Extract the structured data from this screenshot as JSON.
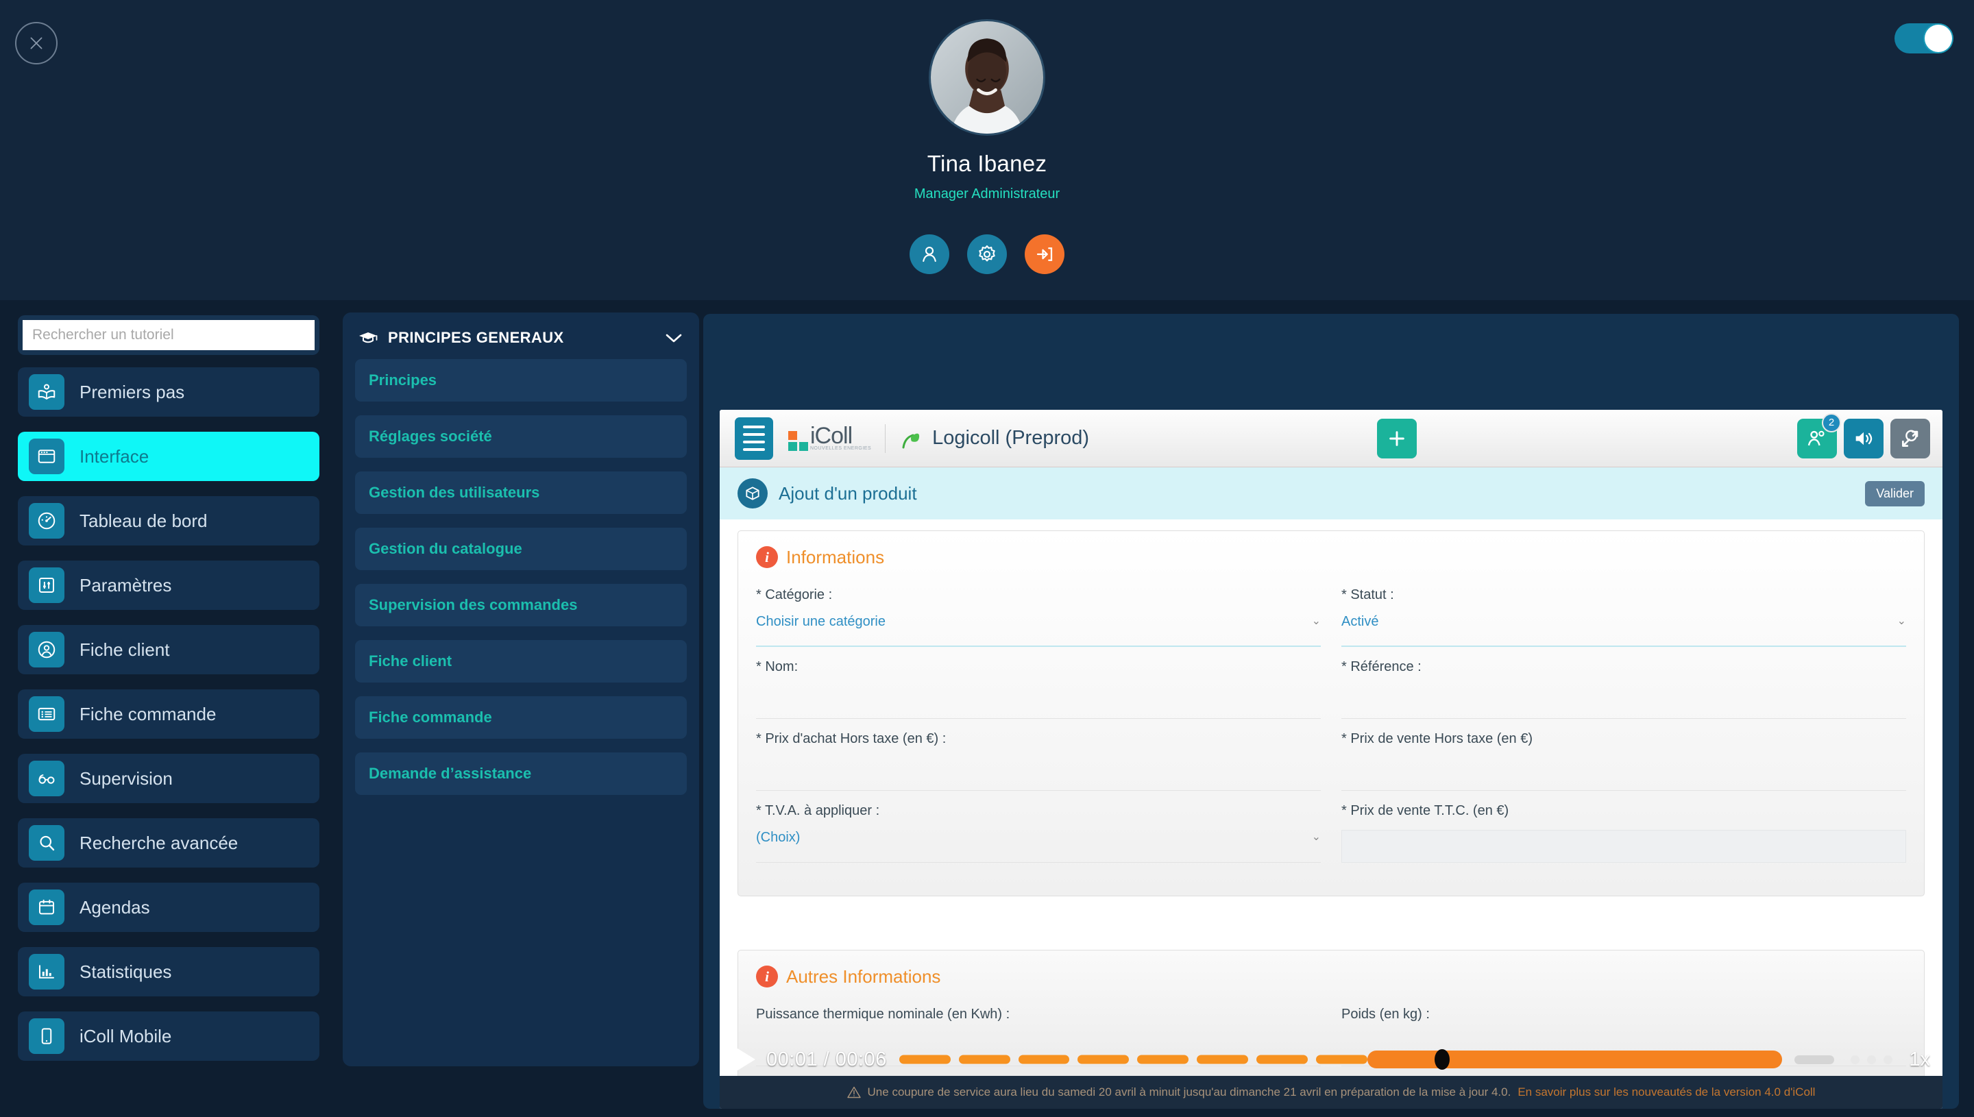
{
  "header": {
    "close_label": "×",
    "user_name": "Tina Ibanez",
    "user_role": "Manager Administrateur",
    "toggle_state": "on",
    "actions": [
      {
        "name": "profile",
        "icon": "user-icon",
        "color": "#1b7fa3"
      },
      {
        "name": "settings",
        "icon": "gear-icon",
        "color": "#1b7fa3"
      },
      {
        "name": "logout",
        "icon": "logout-icon",
        "color": "#f4722b"
      }
    ]
  },
  "sidebar": {
    "search_placeholder": "Rechercher un tutoriel",
    "search_value": "",
    "items": [
      {
        "label": "Premiers pas",
        "icon": "book-reader-icon",
        "active": false
      },
      {
        "label": "Interface",
        "icon": "window-icon",
        "active": true
      },
      {
        "label": "Tableau de bord",
        "icon": "gauge-icon",
        "active": false
      },
      {
        "label": "Paramètres",
        "icon": "sliders-icon",
        "active": false
      },
      {
        "label": "Fiche client",
        "icon": "user-circle-icon",
        "active": false
      },
      {
        "label": "Fiche commande",
        "icon": "list-card-icon",
        "active": false
      },
      {
        "label": "Supervision",
        "icon": "glasses-icon",
        "active": false
      },
      {
        "label": "Recherche avancée",
        "icon": "search-icon",
        "active": false
      },
      {
        "label": "Agendas",
        "icon": "calendar-icon",
        "active": false
      },
      {
        "label": "Statistiques",
        "icon": "bar-chart-icon",
        "active": false
      },
      {
        "label": "iColl Mobile",
        "icon": "mobile-icon",
        "active": false
      }
    ]
  },
  "midcol": {
    "section_title": "PRINCIPES GENERAUX",
    "section_icon": "graduation-cap-icon",
    "chevron": "chevron-down-icon",
    "items": [
      {
        "label": "Principes"
      },
      {
        "label": "Réglages société"
      },
      {
        "label": "Gestion des utilisateurs"
      },
      {
        "label": "Gestion du catalogue"
      },
      {
        "label": "Supervision des commandes"
      },
      {
        "label": "Fiche client"
      },
      {
        "label": "Fiche commande"
      },
      {
        "label": "Demande d’assistance"
      }
    ]
  },
  "app": {
    "brand_name": "iColl",
    "brand_sub": "NOUVELLES ENERGIES",
    "app_title": "Logicoll (Preprod)",
    "add_label": "+",
    "contacts_badge": "2",
    "page_title": "Ajout d'un produit",
    "validate_label": "Valider",
    "sections": [
      {
        "title": "Informations",
        "fields": [
          {
            "label": "* Catégorie :",
            "value": "Choisir une catégorie",
            "type": "select",
            "active": true
          },
          {
            "label": "* Statut :",
            "value": "Activé",
            "type": "select",
            "active": true
          },
          {
            "label": "* Nom:",
            "value": "",
            "type": "text",
            "active": false
          },
          {
            "label": "* Référence :",
            "value": "",
            "type": "text",
            "active": false
          },
          {
            "label": "* Prix d'achat Hors taxe (en €) :",
            "value": "",
            "type": "text",
            "active": false
          },
          {
            "label": "* Prix de vente Hors taxe (en €)",
            "value": "",
            "type": "text",
            "active": false
          },
          {
            "label": "* T.V.A. à appliquer :",
            "value": "(Choix)",
            "type": "select",
            "active": false
          },
          {
            "label": "* Prix de vente T.T.C. (en €)",
            "value": "",
            "type": "readonly",
            "active": false
          }
        ]
      },
      {
        "title": "Autres Informations",
        "fields": [
          {
            "label": "Puissance thermique nominale (en Kwh) :",
            "value": "",
            "type": "text",
            "active": false
          },
          {
            "label": "Poids (en kg) :",
            "value": "",
            "type": "text",
            "active": false
          }
        ]
      }
    ],
    "footer_warning": "Une coupure de service aura lieu du samedi 20 avril à minuit jusqu'au dimanche 21 avril en préparation de la mise à jour 4.0.",
    "footer_link": "En savoir plus sur les nouveautés de la version 4.0 d'iColl"
  },
  "player": {
    "current_time": "00:01",
    "duration": "00:06",
    "time_display": "00:01 / 00:06",
    "speed": "1x",
    "progress_percent": 62,
    "play_state": "paused"
  }
}
